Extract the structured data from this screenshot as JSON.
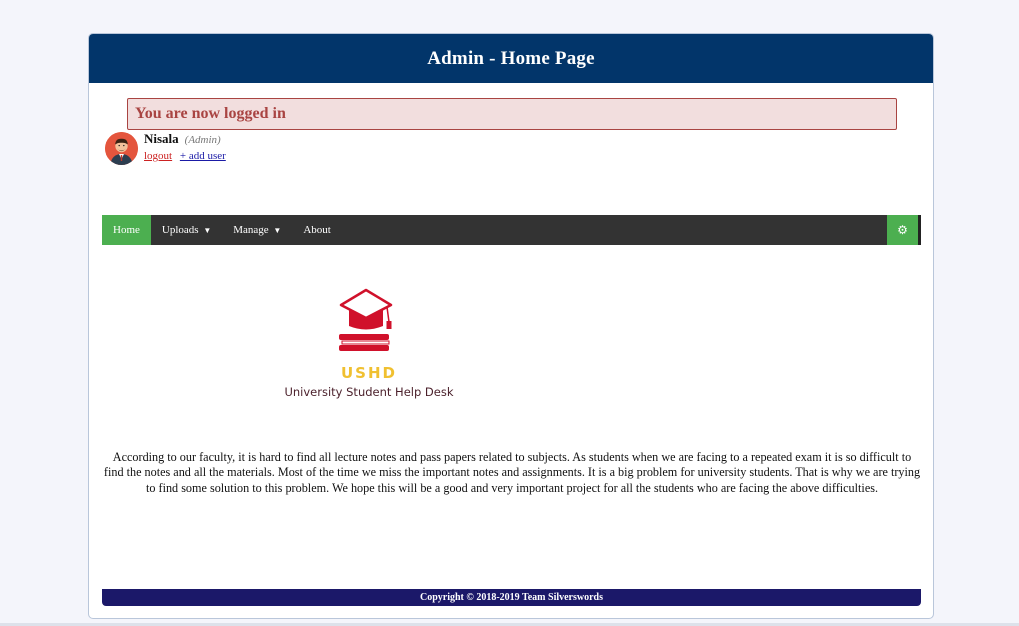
{
  "header": {
    "title": "Admin - Home Page"
  },
  "alert": {
    "message": "You are now logged in"
  },
  "user": {
    "name": "Nisala",
    "role": "(Admin)",
    "logout_label": "logout",
    "add_user_label": "+ add user"
  },
  "nav": {
    "items": [
      {
        "label": "Home",
        "active": true
      },
      {
        "label": "Uploads",
        "dropdown": true
      },
      {
        "label": "Manage",
        "dropdown": true
      },
      {
        "label": "About"
      }
    ],
    "settings_icon": "gear-icon"
  },
  "logo": {
    "acronym": "USHD",
    "name": "University Student Help Desk"
  },
  "about": {
    "text": "According to our faculty, it is hard to find all lecture notes and pass papers related to subjects. As students when we are facing to a repeated exam it is so difficult to find the notes and all the materials. Most of the time we miss the important notes and assignments. It is a big problem for university students. That is why we are trying to find some solution to this problem. We hope this will be a good and very important project for all the students who are facing the above difficulties."
  },
  "footer": {
    "text": "Copyright © 2018-2019 Team Silverswords"
  },
  "colors": {
    "header_bg": "#02356a",
    "alert_bg": "#f2dede",
    "alert_text": "#a94442",
    "nav_bg": "#333333",
    "nav_active": "#4caf50",
    "footer_bg": "#1b1869"
  }
}
